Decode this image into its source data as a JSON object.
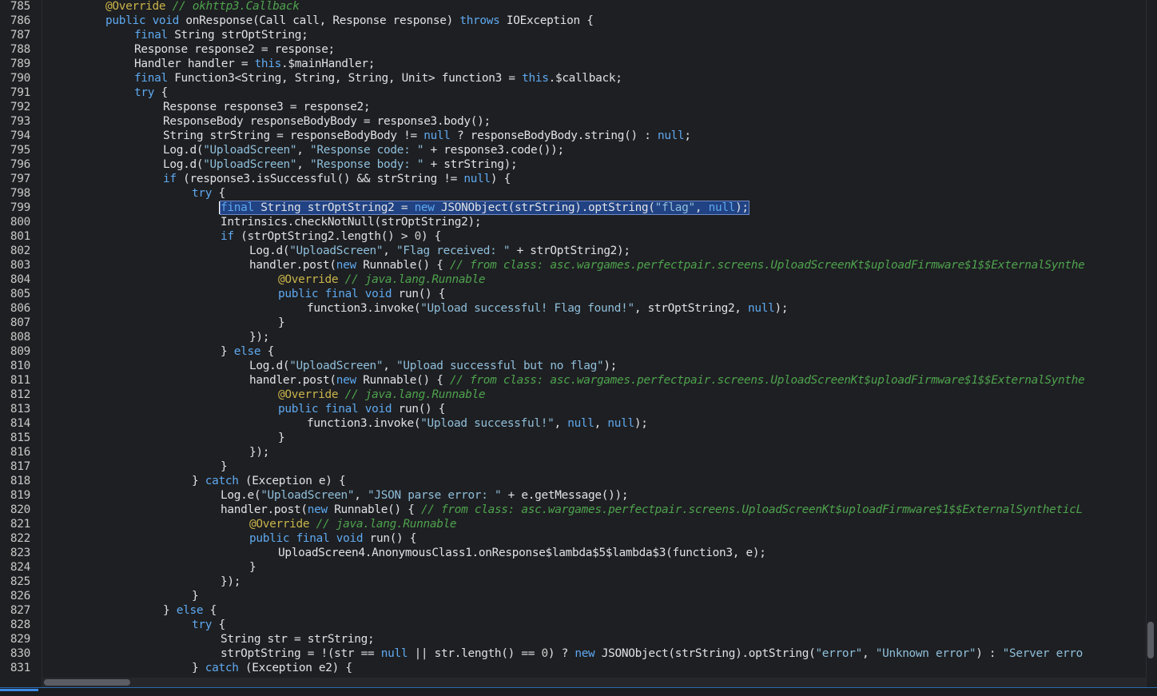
{
  "colors": {
    "background": "#1e1f22",
    "keyword": "#5ea9f0",
    "string": "#8fbfdb",
    "comment": "#4ea34e",
    "annotation": "#c9b44a",
    "selection": "#214283",
    "accent": "#3c8ce7"
  },
  "lines": [
    {
      "n": "785",
      "i": 2,
      "t": [
        [
          "ann",
          "@Override"
        ],
        [
          "p",
          " "
        ],
        [
          "cm",
          "// okhttp3.Callback"
        ]
      ]
    },
    {
      "n": "786",
      "i": 2,
      "t": [
        [
          "kw",
          "public"
        ],
        [
          "p",
          " "
        ],
        [
          "kw",
          "void"
        ],
        [
          "p",
          " onResponse(Call call, Response response) "
        ],
        [
          "kw",
          "throws"
        ],
        [
          "p",
          " IOException {"
        ]
      ]
    },
    {
      "n": "787",
      "i": 3,
      "t": [
        [
          "kw",
          "final"
        ],
        [
          "p",
          " String strOptString;"
        ]
      ]
    },
    {
      "n": "788",
      "i": 3,
      "t": [
        [
          "p",
          "Response response2 = response;"
        ]
      ]
    },
    {
      "n": "789",
      "i": 3,
      "t": [
        [
          "p",
          "Handler handler = "
        ],
        [
          "kw",
          "this"
        ],
        [
          "p",
          ".$mainHandler;"
        ]
      ]
    },
    {
      "n": "790",
      "i": 3,
      "t": [
        [
          "kw",
          "final"
        ],
        [
          "p",
          " Function3<String, String, String, Unit> function3 = "
        ],
        [
          "kw",
          "this"
        ],
        [
          "p",
          ".$callback;"
        ]
      ]
    },
    {
      "n": "791",
      "i": 3,
      "t": [
        [
          "kw",
          "try"
        ],
        [
          "p",
          " {"
        ]
      ]
    },
    {
      "n": "792",
      "i": 4,
      "t": [
        [
          "p",
          "Response response3 = response2;"
        ]
      ]
    },
    {
      "n": "793",
      "i": 4,
      "t": [
        [
          "p",
          "ResponseBody responseBodyBody = response3.body();"
        ]
      ]
    },
    {
      "n": "794",
      "i": 4,
      "t": [
        [
          "p",
          "String strString = responseBodyBody != "
        ],
        [
          "kw",
          "null"
        ],
        [
          "p",
          " ? responseBodyBody.string() : "
        ],
        [
          "kw",
          "null"
        ],
        [
          "p",
          ";"
        ]
      ]
    },
    {
      "n": "795",
      "i": 4,
      "t": [
        [
          "p",
          "Log.d("
        ],
        [
          "str",
          "\"UploadScreen\""
        ],
        [
          "p",
          ", "
        ],
        [
          "str",
          "\"Response code: \""
        ],
        [
          "p",
          " + response3.code());"
        ]
      ]
    },
    {
      "n": "796",
      "i": 4,
      "t": [
        [
          "p",
          "Log.d("
        ],
        [
          "str",
          "\"UploadScreen\""
        ],
        [
          "p",
          ", "
        ],
        [
          "str",
          "\"Response body: \""
        ],
        [
          "p",
          " + strString);"
        ]
      ]
    },
    {
      "n": "797",
      "i": 4,
      "t": [
        [
          "kw",
          "if"
        ],
        [
          "p",
          " (response3.isSuccessful() && strString != "
        ],
        [
          "kw",
          "null"
        ],
        [
          "p",
          ") {"
        ]
      ]
    },
    {
      "n": "798",
      "i": 5,
      "t": [
        [
          "kw",
          "try"
        ],
        [
          "p",
          " {"
        ]
      ]
    },
    {
      "n": "799",
      "i": 6,
      "sel": true,
      "t": [
        [
          "kw",
          "final"
        ],
        [
          "p",
          " String strOptString2 = "
        ],
        [
          "kw",
          "new"
        ],
        [
          "p",
          " JSONObject(strString).optString("
        ],
        [
          "str",
          "\"flag\""
        ],
        [
          "p",
          ", "
        ],
        [
          "kw",
          "null"
        ],
        [
          "p",
          ");"
        ]
      ]
    },
    {
      "n": "800",
      "i": 6,
      "t": [
        [
          "p",
          "Intrinsics.checkNotNull(strOptString2);"
        ]
      ]
    },
    {
      "n": "801",
      "i": 6,
      "t": [
        [
          "kw",
          "if"
        ],
        [
          "p",
          " (strOptString2.length() > "
        ],
        [
          "num",
          "0"
        ],
        [
          "p",
          ") {"
        ]
      ]
    },
    {
      "n": "802",
      "i": 7,
      "t": [
        [
          "p",
          "Log.d("
        ],
        [
          "str",
          "\"UploadScreen\""
        ],
        [
          "p",
          ", "
        ],
        [
          "str",
          "\"Flag received: \""
        ],
        [
          "p",
          " + strOptString2);"
        ]
      ]
    },
    {
      "n": "803",
      "i": 7,
      "t": [
        [
          "p",
          "handler.post("
        ],
        [
          "kw",
          "new"
        ],
        [
          "p",
          " Runnable() { "
        ],
        [
          "cm",
          "// from class: asc.wargames.perfectpair.screens.UploadScreenKt$uploadFirmware$1$$ExternalSynthe"
        ]
      ]
    },
    {
      "n": "804",
      "i": 8,
      "t": [
        [
          "ann",
          "@Override"
        ],
        [
          "p",
          " "
        ],
        [
          "cm",
          "// java.lang.Runnable"
        ]
      ]
    },
    {
      "n": "805",
      "i": 8,
      "t": [
        [
          "kw",
          "public"
        ],
        [
          "p",
          " "
        ],
        [
          "kw",
          "final"
        ],
        [
          "p",
          " "
        ],
        [
          "kw",
          "void"
        ],
        [
          "p",
          " run() {"
        ]
      ]
    },
    {
      "n": "806",
      "i": 9,
      "t": [
        [
          "p",
          "function3.invoke("
        ],
        [
          "str",
          "\"Upload successful! Flag found!\""
        ],
        [
          "p",
          ", strOptString2, "
        ],
        [
          "kw",
          "null"
        ],
        [
          "p",
          ");"
        ]
      ]
    },
    {
      "n": "807",
      "i": 8,
      "t": [
        [
          "p",
          "}"
        ]
      ]
    },
    {
      "n": "808",
      "i": 7,
      "t": [
        [
          "p",
          "});"
        ]
      ]
    },
    {
      "n": "809",
      "i": 6,
      "t": [
        [
          "p",
          "} "
        ],
        [
          "kw",
          "else"
        ],
        [
          "p",
          " {"
        ]
      ]
    },
    {
      "n": "810",
      "i": 7,
      "t": [
        [
          "p",
          "Log.d("
        ],
        [
          "str",
          "\"UploadScreen\""
        ],
        [
          "p",
          ", "
        ],
        [
          "str",
          "\"Upload successful but no flag\""
        ],
        [
          "p",
          ");"
        ]
      ]
    },
    {
      "n": "811",
      "i": 7,
      "t": [
        [
          "p",
          "handler.post("
        ],
        [
          "kw",
          "new"
        ],
        [
          "p",
          " Runnable() { "
        ],
        [
          "cm",
          "// from class: asc.wargames.perfectpair.screens.UploadScreenKt$uploadFirmware$1$$ExternalSynthe"
        ]
      ]
    },
    {
      "n": "812",
      "i": 8,
      "t": [
        [
          "ann",
          "@Override"
        ],
        [
          "p",
          " "
        ],
        [
          "cm",
          "// java.lang.Runnable"
        ]
      ]
    },
    {
      "n": "813",
      "i": 8,
      "t": [
        [
          "kw",
          "public"
        ],
        [
          "p",
          " "
        ],
        [
          "kw",
          "final"
        ],
        [
          "p",
          " "
        ],
        [
          "kw",
          "void"
        ],
        [
          "p",
          " run() {"
        ]
      ]
    },
    {
      "n": "814",
      "i": 9,
      "t": [
        [
          "p",
          "function3.invoke("
        ],
        [
          "str",
          "\"Upload successful!\""
        ],
        [
          "p",
          ", "
        ],
        [
          "kw",
          "null"
        ],
        [
          "p",
          ", "
        ],
        [
          "kw",
          "null"
        ],
        [
          "p",
          ");"
        ]
      ]
    },
    {
      "n": "815",
      "i": 8,
      "t": [
        [
          "p",
          "}"
        ]
      ]
    },
    {
      "n": "816",
      "i": 7,
      "t": [
        [
          "p",
          "});"
        ]
      ]
    },
    {
      "n": "817",
      "i": 6,
      "t": [
        [
          "p",
          "}"
        ]
      ]
    },
    {
      "n": "818",
      "i": 5,
      "t": [
        [
          "p",
          "} "
        ],
        [
          "kw",
          "catch"
        ],
        [
          "p",
          " (Exception e) {"
        ]
      ]
    },
    {
      "n": "819",
      "i": 6,
      "t": [
        [
          "p",
          "Log.e("
        ],
        [
          "str",
          "\"UploadScreen\""
        ],
        [
          "p",
          ", "
        ],
        [
          "str",
          "\"JSON parse error: \""
        ],
        [
          "p",
          " + e.getMessage());"
        ]
      ]
    },
    {
      "n": "820",
      "i": 6,
      "t": [
        [
          "p",
          "handler.post("
        ],
        [
          "kw",
          "new"
        ],
        [
          "p",
          " Runnable() { "
        ],
        [
          "cm",
          "// from class: asc.wargames.perfectpair.screens.UploadScreenKt$uploadFirmware$1$$ExternalSyntheticL"
        ]
      ]
    },
    {
      "n": "821",
      "i": 7,
      "t": [
        [
          "ann",
          "@Override"
        ],
        [
          "p",
          " "
        ],
        [
          "cm",
          "// java.lang.Runnable"
        ]
      ]
    },
    {
      "n": "822",
      "i": 7,
      "t": [
        [
          "kw",
          "public"
        ],
        [
          "p",
          " "
        ],
        [
          "kw",
          "final"
        ],
        [
          "p",
          " "
        ],
        [
          "kw",
          "void"
        ],
        [
          "p",
          " run() {"
        ]
      ]
    },
    {
      "n": "823",
      "i": 8,
      "t": [
        [
          "p",
          "UploadScreen4.AnonymousClass1.onResponse$lambda$5$lambda$3(function3, e);"
        ]
      ]
    },
    {
      "n": "824",
      "i": 7,
      "t": [
        [
          "p",
          "}"
        ]
      ]
    },
    {
      "n": "825",
      "i": 6,
      "t": [
        [
          "p",
          "});"
        ]
      ]
    },
    {
      "n": "826",
      "i": 5,
      "t": [
        [
          "p",
          "}"
        ]
      ]
    },
    {
      "n": "827",
      "i": 4,
      "t": [
        [
          "p",
          "} "
        ],
        [
          "kw",
          "else"
        ],
        [
          "p",
          " {"
        ]
      ]
    },
    {
      "n": "828",
      "i": 5,
      "t": [
        [
          "kw",
          "try"
        ],
        [
          "p",
          " {"
        ]
      ]
    },
    {
      "n": "829",
      "i": 6,
      "t": [
        [
          "p",
          "String str = strString;"
        ]
      ]
    },
    {
      "n": "830",
      "i": 6,
      "t": [
        [
          "p",
          "strOptString = !(str == "
        ],
        [
          "kw",
          "null"
        ],
        [
          "p",
          " || str.length() == "
        ],
        [
          "num",
          "0"
        ],
        [
          "p",
          ") ? "
        ],
        [
          "kw",
          "new"
        ],
        [
          "p",
          " JSONObject(strString).optString("
        ],
        [
          "str",
          "\"error\""
        ],
        [
          "p",
          ", "
        ],
        [
          "str",
          "\"Unknown error\""
        ],
        [
          "p",
          ") : "
        ],
        [
          "str",
          "\"Server erro"
        ]
      ]
    },
    {
      "n": "831",
      "i": 5,
      "t": [
        [
          "p",
          "} "
        ],
        [
          "kw",
          "catch"
        ],
        [
          "p",
          " (Exception e2) {"
        ]
      ]
    }
  ]
}
